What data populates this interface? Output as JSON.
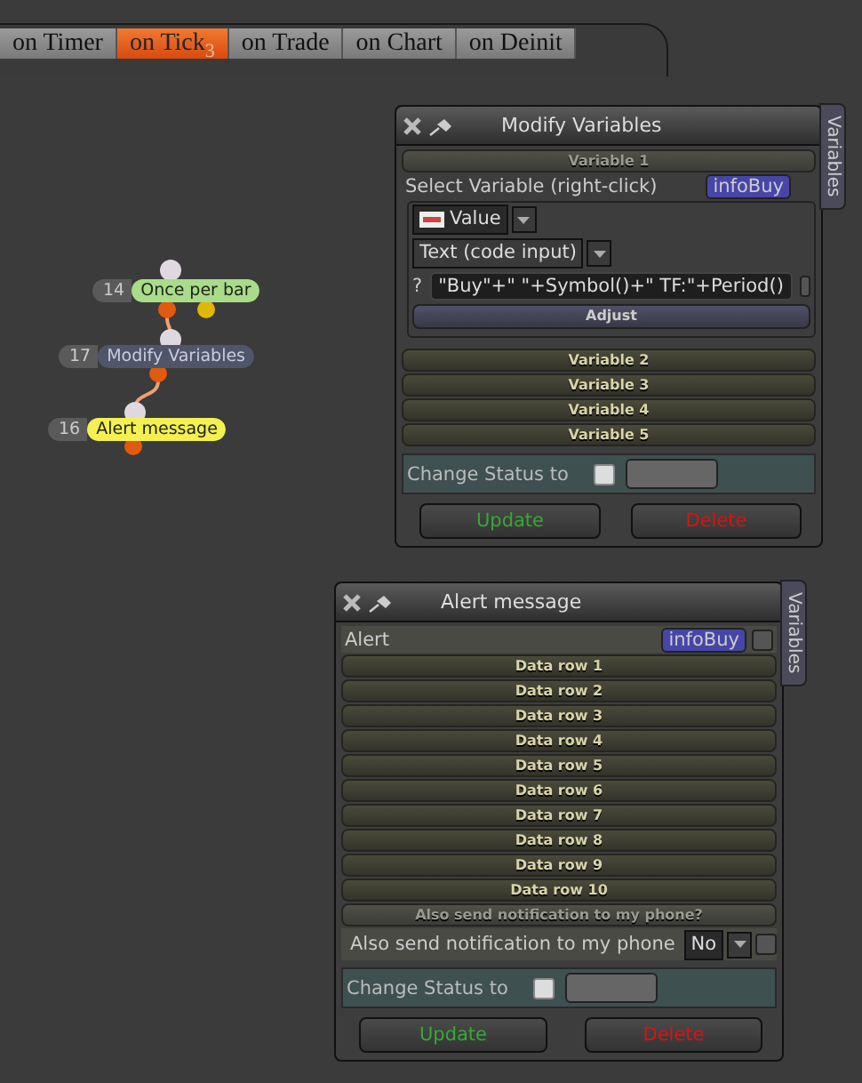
{
  "tabs": [
    {
      "label": "on Timer",
      "selected": false
    },
    {
      "label": "on Tick$_{3}$",
      "selected": true
    },
    {
      "label": "on Trade",
      "selected": false
    },
    {
      "label": "on Chart",
      "selected": false
    },
    {
      "label": "on Deinit",
      "selected": false
    }
  ],
  "nodes": [
    {
      "number": "14",
      "label": "Once per bar",
      "color": "#a8dc88"
    },
    {
      "number": "17",
      "label": "Modify Variables",
      "color": "#50566a"
    },
    {
      "number": "16",
      "label": "Alert message",
      "color": "#f4f050"
    }
  ],
  "modify_window": {
    "title": "Modify Variables",
    "side_tab": "Variables",
    "variable_1": {
      "header": "Variable 1",
      "select_label": "Select Variable (right-click)",
      "variable": "infoBuy",
      "value_type": "Value",
      "input_type": "Text (code input)",
      "prefix": "?",
      "expression": "\"Buy\"+\" \"+Symbol()+\" TF:\"+Period()",
      "checked": false,
      "adjust": "Adjust"
    },
    "collapsed_variables": [
      "Variable 2",
      "Variable 3",
      "Variable 4",
      "Variable 5"
    ],
    "status": {
      "label": "Change Status to",
      "checked": false
    },
    "buttons": [
      {
        "label": "Update",
        "kind": "update"
      },
      {
        "label": "Delete",
        "kind": "delete"
      }
    ]
  },
  "alert_window": {
    "title": "Alert message",
    "side_tab": "Variables",
    "alert": {
      "label": "Alert",
      "variable": "infoBuy",
      "checked": false
    },
    "data_rows": [
      "Data row 1",
      "Data row 2",
      "Data row 3",
      "Data row 4",
      "Data row 5",
      "Data row 6",
      "Data row 7",
      "Data row 8",
      "Data row 9",
      "Data row 10"
    ],
    "notify": {
      "header": "Also send notification to my phone?",
      "label": "Also send notification to my phone",
      "value": "No",
      "checked": false
    },
    "status": {
      "label": "Change Status to",
      "checked": false
    },
    "buttons": [
      {
        "label": "Update",
        "kind": "update"
      },
      {
        "label": "Delete",
        "kind": "delete"
      }
    ]
  }
}
